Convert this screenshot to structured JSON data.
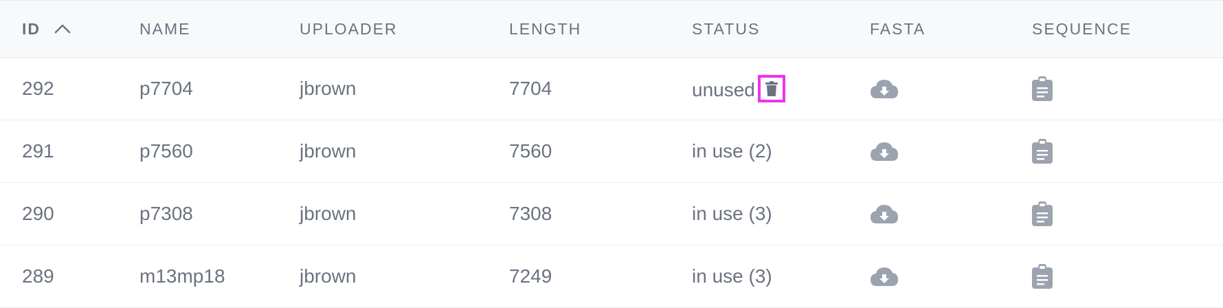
{
  "columns": {
    "id": "ID",
    "name": "NAME",
    "uploader": "UPLOADER",
    "length": "LENGTH",
    "status": "STATUS",
    "fasta": "FASTA",
    "sequence": "SEQUENCE"
  },
  "sort": {
    "column": "ID",
    "direction": "ascending",
    "icon": "chevron-up-icon"
  },
  "rows": [
    {
      "id": "292",
      "name": "p7704",
      "uploader": "jbrown",
      "length": "7704",
      "status": "unused"
    },
    {
      "id": "291",
      "name": "p7560",
      "uploader": "jbrown",
      "length": "7560",
      "status": "in use (2)"
    },
    {
      "id": "290",
      "name": "p7308",
      "uploader": "jbrown",
      "length": "7308",
      "status": "in use (3)"
    },
    {
      "id": "289",
      "name": "m13mp18",
      "uploader": "jbrown",
      "length": "7249",
      "status": "in use (3)"
    }
  ],
  "icons": {
    "fasta": "cloud-download-icon",
    "sequence": "clipboard-icon",
    "delete": "trash-icon"
  },
  "colors": {
    "header_bg": "#f8f9fb",
    "text": "#6b7280",
    "icon": "#9ca3af",
    "highlight": "#ee33ee"
  }
}
